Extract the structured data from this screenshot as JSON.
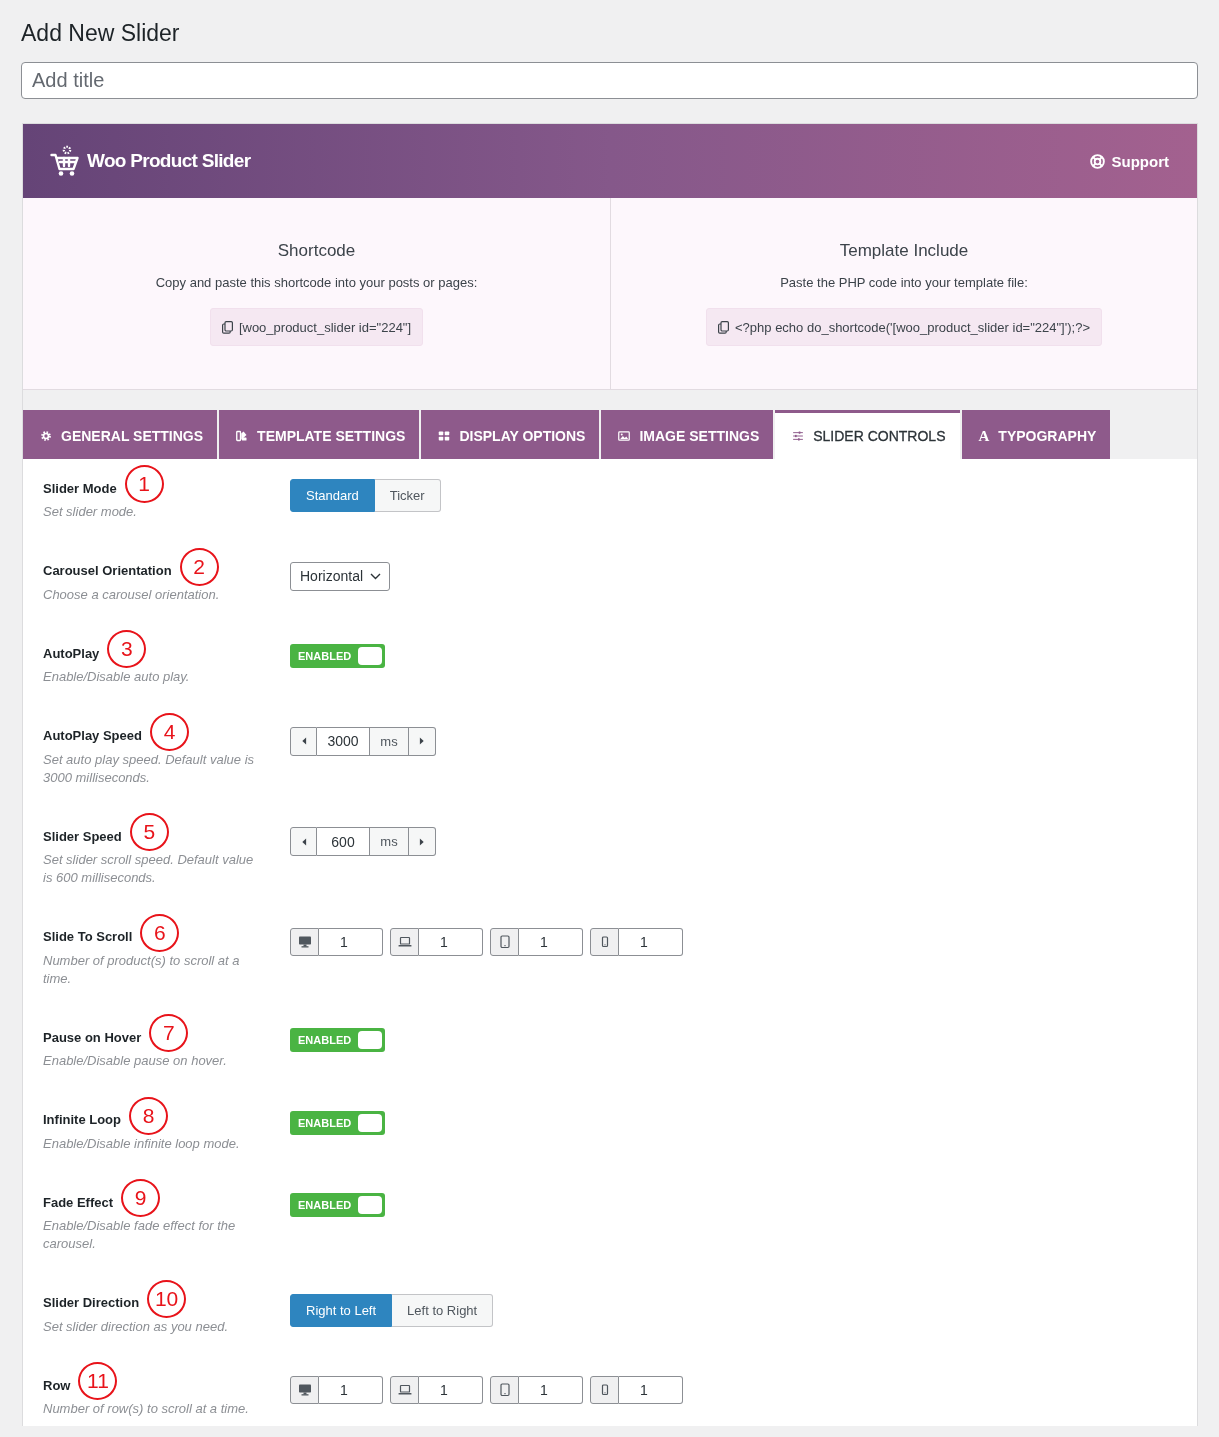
{
  "page": {
    "title": "Add New Slider"
  },
  "title_field": {
    "placeholder": "Add title"
  },
  "header": {
    "brand": "Woo Product Slider",
    "support": "Support"
  },
  "embed": [
    {
      "heading": "Shortcode",
      "hint": "Copy and paste this shortcode into your posts or pages:",
      "code": "[woo_product_slider id=\"224\"]"
    },
    {
      "heading": "Template Include",
      "hint": "Paste the PHP code into your template file:",
      "code": "<?php echo do_shortcode('[woo_product_slider id=\"224\"]');?>"
    }
  ],
  "tabs": [
    {
      "label": "GENERAL SETTINGS",
      "selected": false
    },
    {
      "label": "TEMPLATE SETTINGS",
      "selected": false
    },
    {
      "label": "DISPLAY OPTIONS",
      "selected": false
    },
    {
      "label": "IMAGE SETTINGS",
      "selected": false
    },
    {
      "label": "SLIDER CONTROLS",
      "selected": true
    },
    {
      "label": "TYPOGRAPHY",
      "selected": false,
      "glyph": "A"
    }
  ],
  "settings": [
    {
      "kind": "button_group",
      "label": "Slider Mode",
      "marker": "1",
      "description": "Set slider mode.",
      "options": [
        {
          "label": "Standard",
          "selected": true
        },
        {
          "label": "Ticker",
          "selected": false
        }
      ]
    },
    {
      "kind": "select",
      "label": "Carousel Orientation",
      "marker": "2",
      "description": "Choose a carousel orientation.",
      "value": "Horizontal"
    },
    {
      "kind": "toggle",
      "label": "AutoPlay",
      "marker": "3",
      "description": "Enable/Disable auto play.",
      "on": true,
      "state_label": "ENABLED"
    },
    {
      "kind": "spinner",
      "label": "AutoPlay Speed",
      "marker": "4",
      "description": "Set auto play speed. Default value is 3000 milliseconds.",
      "value": "3000",
      "unit": "ms"
    },
    {
      "kind": "spinner",
      "label": "Slider Speed",
      "marker": "5",
      "description": "Set slider scroll speed. Default value is 600 milliseconds.",
      "value": "600",
      "unit": "ms"
    },
    {
      "kind": "responsive",
      "label": "Slide To Scroll",
      "marker": "6",
      "description": "Number of product(s) to scroll at a time.",
      "values": [
        "1",
        "1",
        "1",
        "1"
      ]
    },
    {
      "kind": "toggle",
      "label": "Pause on Hover",
      "marker": "7",
      "description": "Enable/Disable pause on hover.",
      "on": true,
      "state_label": "ENABLED"
    },
    {
      "kind": "toggle",
      "label": "Infinite Loop",
      "marker": "8",
      "description": "Enable/Disable infinite loop mode.",
      "on": true,
      "state_label": "ENABLED"
    },
    {
      "kind": "toggle",
      "label": "Fade Effect",
      "marker": "9",
      "description": "Enable/Disable fade effect for the carousel.",
      "on": true,
      "state_label": "ENABLED"
    },
    {
      "kind": "button_group",
      "label": "Slider Direction",
      "marker": "10",
      "description": "Set slider direction as you need.",
      "options": [
        {
          "label": "Right to Left",
          "selected": true
        },
        {
          "label": "Left to Right",
          "selected": false
        }
      ]
    },
    {
      "kind": "responsive",
      "label": "Row",
      "marker": "11",
      "description": "Number of row(s) to scroll at a time.",
      "values": [
        "1",
        "1",
        "1",
        "1"
      ]
    }
  ]
}
